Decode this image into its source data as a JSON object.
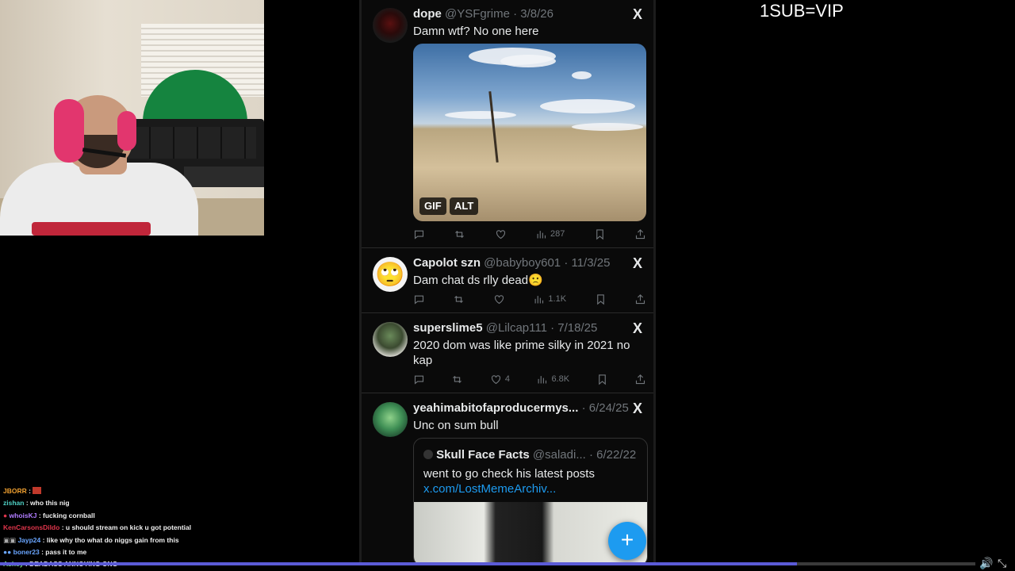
{
  "overlay": {
    "sub_vip": "1SUB=VIP"
  },
  "posts": [
    {
      "name": "dope",
      "handle": "@YSFgrime",
      "date": "· 3/8/26",
      "text": "Damn wtf? No one here",
      "media_badges": [
        "GIF",
        "ALT"
      ],
      "views": "287",
      "likes": ""
    },
    {
      "name": "Capolot szn",
      "handle": "@babyboy601",
      "date": "· 11/3/25",
      "text": "Dam chat ds rlly dead🙁",
      "views": "1.1K",
      "likes": ""
    },
    {
      "name": "superslime5",
      "handle": "@Lilcap111",
      "date": "· 7/18/25",
      "text": "2020 dom was like prime silky in 2021 no kap",
      "views": "6.8K",
      "likes": "4"
    },
    {
      "name": "yeahimabitofaproducermys...",
      "handle": "",
      "date": "· 6/24/25",
      "text": "Unc on sum bull",
      "quote": {
        "name": "Skull Face Facts",
        "handle": "@saladi...",
        "date": "· 6/22/22",
        "text": "went to go check his latest posts ",
        "link": "x.com/LostMemeArchiv..."
      }
    }
  ],
  "x_logo": "X",
  "fab_label": "+",
  "chat": [
    {
      "user": "JBORR",
      "msg": ":",
      "color": "#f0a030"
    },
    {
      "user": "zishan",
      "msg": ": who this nig",
      "color": "#4fd1c5"
    },
    {
      "user": "whoisKJ",
      "msg": ": fucking cornball",
      "color": "#b07cff"
    },
    {
      "user": "KenCarsonsDildo",
      "msg": ": u should stream on kick u got potential",
      "color": "#e0354b"
    },
    {
      "user": "Jayp24",
      "msg": ": like why tho what do niggs gain from this",
      "color": "#6aa6ff"
    },
    {
      "user": "boner23",
      "msg": ": pass it to me",
      "color": "#6aa6ff"
    },
    {
      "user": "Ashey",
      "msg": ": DEADASS ANNOYING ONG",
      "color": "#7ee07e"
    }
  ],
  "colors": {
    "accent": "#1d9bf0",
    "progress": "#5b5bd6"
  },
  "progress": {
    "fraction": 0.817
  }
}
